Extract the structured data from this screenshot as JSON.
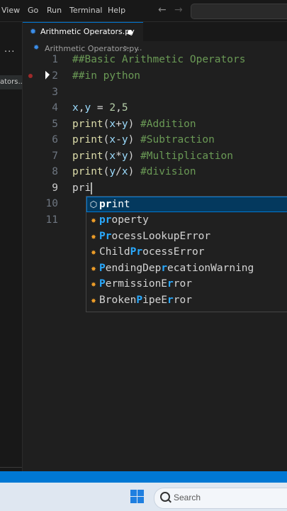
{
  "menubar": {
    "items": [
      "View",
      "Go",
      "Run",
      "Terminal",
      "Help"
    ],
    "back_glyph": "←",
    "forward_glyph": "→"
  },
  "sidebar": {
    "more_glyph": "···",
    "item_label": "ators...."
  },
  "tab": {
    "label": "Arithmetic Operators.py",
    "icon": "python-file-icon",
    "dirty": true
  },
  "breadcrumb": {
    "file": "Arithmetic Operators.py",
    "separator": ">",
    "more": "..."
  },
  "editor": {
    "lines": [
      {
        "n": "1",
        "text": "##Basic Arithmetic Operators"
      },
      {
        "n": "2",
        "text": "##in python"
      },
      {
        "n": "3",
        "text": ""
      },
      {
        "n": "4",
        "text": "x,y = 2,5"
      },
      {
        "n": "5",
        "text": "print(x+y) #Addition"
      },
      {
        "n": "6",
        "text": "print(x-y) #Subtraction"
      },
      {
        "n": "7",
        "text": "print(x*y) #Multiplication"
      },
      {
        "n": "8",
        "text": "print(y/x) #division"
      },
      {
        "n": "9",
        "text": "pri"
      },
      {
        "n": "10",
        "text": ""
      },
      {
        "n": "11",
        "text": ""
      }
    ],
    "active_line": "9"
  },
  "suggestions": {
    "selected_index": 0,
    "items": [
      {
        "label": "print",
        "kind": "function",
        "icon": "cube-icon"
      },
      {
        "label": "property",
        "kind": "class",
        "icon": "class-icon"
      },
      {
        "label": "ProcessLookupError",
        "kind": "class",
        "icon": "class-icon"
      },
      {
        "label": "ChildProcessError",
        "kind": "class",
        "icon": "class-icon"
      },
      {
        "label": "PendingDeprecationWarning",
        "kind": "class",
        "icon": "class-icon"
      },
      {
        "label": "PermissionError",
        "kind": "class",
        "icon": "class-icon"
      },
      {
        "label": "BrokenPipeError",
        "kind": "class",
        "icon": "class-icon"
      }
    ]
  },
  "taskbar": {
    "search_label": "Search"
  },
  "colors": {
    "accent": "#0078d4",
    "comment": "#6a9955",
    "function": "#dcdcaa",
    "variable": "#9cdcfe",
    "number": "#b5cea8",
    "match_highlight": "#2aaaff"
  }
}
